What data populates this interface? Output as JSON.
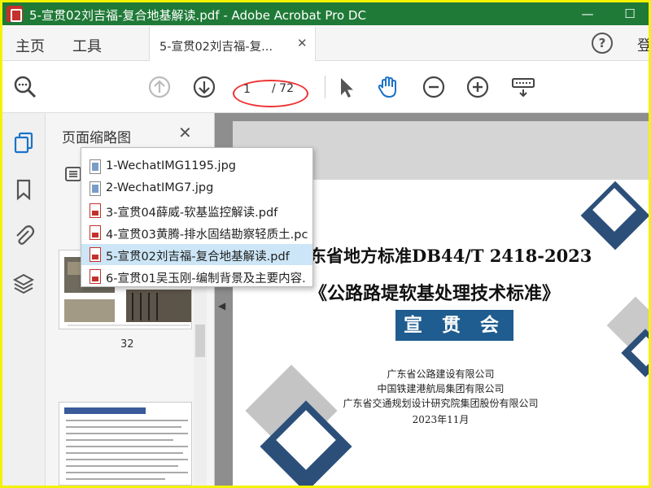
{
  "window": {
    "title": "5-宣贯02刘吉福-复合地基解读.pdf - Adobe Acrobat Pro DC",
    "minimize": "—",
    "maximize": "☐"
  },
  "nav": {
    "home": "主页",
    "tools": "工具",
    "doc_tab": "5-宣贯02刘吉福-复...",
    "close": "✕",
    "help": "?",
    "cut_label": "登"
  },
  "toolbar": {
    "page_current": "1",
    "page_total": "/ 72"
  },
  "thumbnails_panel": {
    "title": "页面缩略图",
    "close": "✕",
    "page_number": "32"
  },
  "tab_list": [
    {
      "label": "1-WechatIMG1195.jpg",
      "type": "img",
      "selected": false
    },
    {
      "label": "2-WechatIMG7.jpg",
      "type": "img",
      "selected": false
    },
    {
      "label": "3-宣贯04薛威-软基监控解读.pdf",
      "type": "pdf",
      "selected": false
    },
    {
      "label": "4-宣贯03黄腾-排水固结勘察轻质土.pc",
      "type": "pdf",
      "selected": false
    },
    {
      "label": "5-宣贯02刘吉福-复合地基解读.pdf",
      "type": "pdf",
      "selected": true
    },
    {
      "label": "6-宣贯01吴玉刚-编制背景及主要内容.",
      "type": "pdf",
      "selected": false
    }
  ],
  "document": {
    "heading1": "东省地方标准DB44/T 2418-2023",
    "heading2": "《公路路堤软基处理技术标准》",
    "box_label": "宣 贯 会",
    "org1": "广东省公路建设有限公司",
    "org2": "中国铁建港航局集团有限公司",
    "org3": "广东省交通规划设计研究院集团股份有限公司",
    "date": "2023年11月"
  },
  "colors": {
    "titlebar": "#1f7a37",
    "accent_blue": "#1f5c8f",
    "highlight_ellipse": "#ee3333",
    "selected_row": "#cce6f7",
    "frame": "#f3f300"
  }
}
